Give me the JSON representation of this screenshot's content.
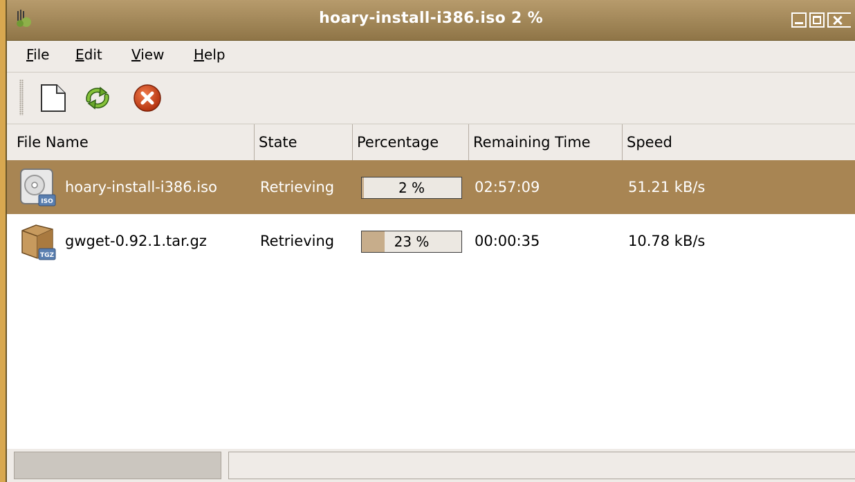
{
  "window": {
    "title": "hoary-install-i386.iso 2 %"
  },
  "menu": {
    "items": [
      {
        "mn": "F",
        "rest": "ile"
      },
      {
        "mn": "E",
        "rest": "dit"
      },
      {
        "mn": "V",
        "rest": "iew"
      },
      {
        "mn": "H",
        "rest": "elp"
      }
    ]
  },
  "toolbar": {
    "buttons": [
      {
        "icon": "new-document-icon"
      },
      {
        "icon": "resume-refresh-icon"
      },
      {
        "icon": "cancel-icon"
      }
    ]
  },
  "columns": [
    "File Name",
    "State",
    "Percentage",
    "Remaining Time",
    "Speed"
  ],
  "downloads": [
    {
      "file_name": "hoary-install-i386.iso",
      "icon": "iso-disc-icon",
      "state": "Retrieving",
      "percentage_label": "2 %",
      "percentage": 2,
      "remaining": "02:57:09",
      "speed": "51.21 kB/s",
      "selected": true
    },
    {
      "file_name": "gwget-0.92.1.tar.gz",
      "icon": "tgz-archive-icon",
      "state": "Retrieving",
      "percentage_label": "23 %",
      "percentage": 23,
      "remaining": "00:00:35",
      "speed": "10.78 kB/s",
      "selected": false
    }
  ],
  "colors": {
    "desktop": "#d8a850",
    "selection": "#a88553",
    "progress_fill": "#c7ad8b",
    "titlebar": "#a4885a"
  }
}
